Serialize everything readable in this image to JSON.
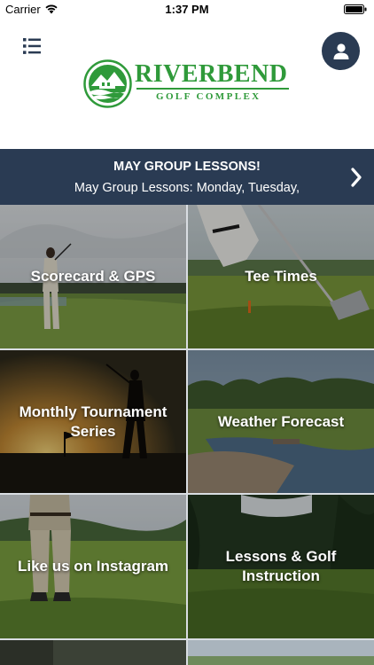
{
  "status_bar": {
    "carrier": "Carrier",
    "time": "1:37 PM",
    "wifi_icon": "wifi-icon",
    "battery_icon": "battery-icon"
  },
  "header": {
    "menu_icon": "list-menu-icon",
    "profile_icon": "user-icon",
    "logo": {
      "name": "RIVERBEND",
      "subtitle": "GOLF COMPLEX"
    }
  },
  "banner": {
    "title": "MAY GROUP LESSONS!",
    "text": "May Group Lessons: Monday, Tuesday,",
    "icon": "chevron-right-icon"
  },
  "tiles": [
    {
      "label": "Scorecard & GPS"
    },
    {
      "label": "Tee Times"
    },
    {
      "label": "Monthly Tournament Series"
    },
    {
      "label": "Weather Forecast"
    },
    {
      "label": "Like us on Instagram"
    },
    {
      "label": "Lessons & Golf Instruction"
    },
    {
      "label": ""
    },
    {
      "label": ""
    }
  ],
  "colors": {
    "navy": "#2a3b53",
    "brand_green": "#2f9a3a",
    "white": "#ffffff"
  }
}
